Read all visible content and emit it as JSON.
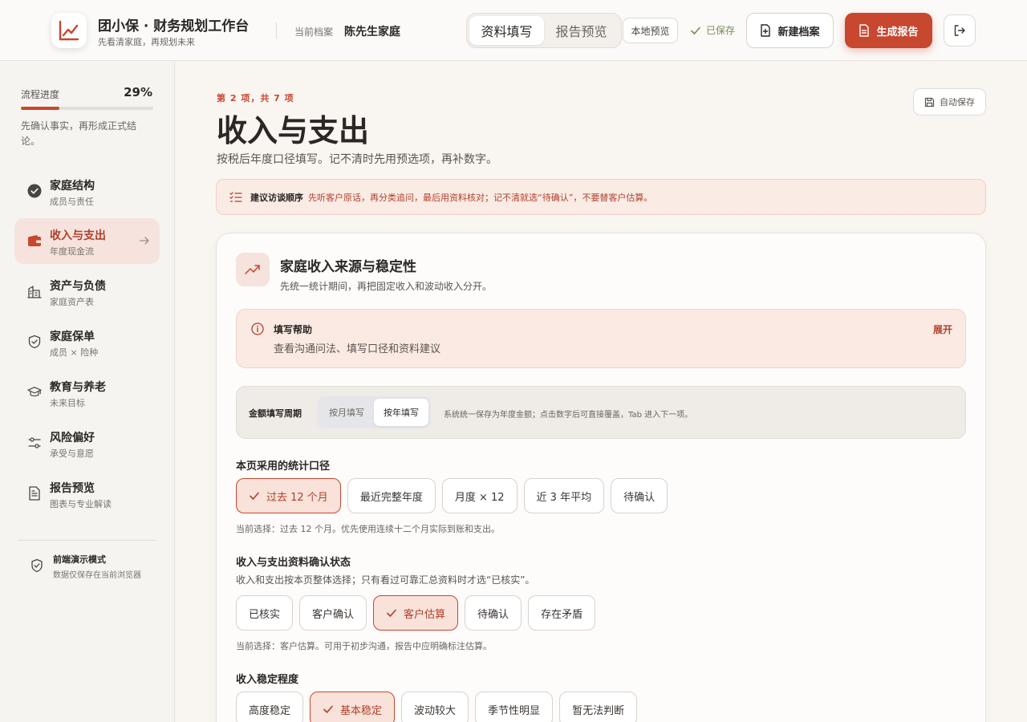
{
  "header": {
    "app_title": "团小保 · 财务规划工作台",
    "app_subtitle": "先看清家庭，再规划未来",
    "profile_label": "当前档案",
    "profile_name": "陈先生家庭",
    "tabs": [
      {
        "label": "资料填写",
        "active": true
      },
      {
        "label": "报告预览",
        "active": false
      }
    ],
    "local_preview": "本地预览",
    "saved_status": "已保存",
    "new_profile": "新建档案",
    "generate_report": "生成报告",
    "accent_color": "#c8472f"
  },
  "sidebar": {
    "progress_label": "流程进度",
    "progress_percent": "29%",
    "progress_value": 0.29,
    "progress_note": "先确认事实，再形成正式结论。",
    "items": [
      {
        "title": "家庭结构",
        "subtitle": "成员与责任",
        "icon": "check-circle-icon",
        "active": false
      },
      {
        "title": "收入与支出",
        "subtitle": "年度现金流",
        "icon": "wallet-icon",
        "active": true
      },
      {
        "title": "资产与负债",
        "subtitle": "家庭资产表",
        "icon": "building-icon",
        "active": false
      },
      {
        "title": "家庭保单",
        "subtitle": "成员 × 险种",
        "icon": "shield-icon",
        "active": false
      },
      {
        "title": "教育与养老",
        "subtitle": "未来目标",
        "icon": "graduation-cap-icon",
        "active": false
      },
      {
        "title": "风险偏好",
        "subtitle": "承受与意愿",
        "icon": "sliders-icon",
        "active": false
      },
      {
        "title": "报告预览",
        "subtitle": "图表与专业解读",
        "icon": "document-icon",
        "active": false
      }
    ],
    "demo_title": "前端演示模式",
    "demo_subtitle": "数据仅保存在当前浏览器"
  },
  "main": {
    "step": "第 2 项，共 7 项",
    "title": "收入与支出",
    "description": "按税后年度口径填写。记不清时先用预选项，再补数字。",
    "autosave": "自动保存",
    "tip_heading": "建议访谈顺序",
    "tip_text": "先听客户原话，再分类追问，最后用资料核对；记不清就选“待确认”，不要替客户估算。",
    "card": {
      "title": "家庭收入来源与稳定性",
      "subtitle": "先统一统计期间，再把固定收入和波动收入分开。",
      "help_title": "填写帮助",
      "help_text": "查看沟通问法、填写口径和资料建议",
      "help_toggle": "展开",
      "period_label": "金额填写周期",
      "period_options": [
        {
          "label": "按月填写",
          "active": false
        },
        {
          "label": "按年填写",
          "active": true
        }
      ],
      "period_note": "系统统一保存为年度金额；点击数字后可直接覆盖，Tab 进入下一项。",
      "section1": {
        "title": "本页采用的统计口径",
        "options": [
          {
            "label": "过去 12 个月",
            "selected": true
          },
          {
            "label": "最近完整年度",
            "selected": false
          },
          {
            "label": "月度 × 12",
            "selected": false
          },
          {
            "label": "近 3 年平均",
            "selected": false
          },
          {
            "label": "待确认",
            "selected": false
          }
        ],
        "note": "当前选择：过去 12 个月。优先使用连续十二个月实际到账和支出。"
      },
      "section2": {
        "title": "收入与支出资料确认状态",
        "description": "收入和支出按本页整体选择；只有看过可靠汇总资料时才选“已核实”。",
        "options": [
          {
            "label": "已核实",
            "selected": false
          },
          {
            "label": "客户确认",
            "selected": false
          },
          {
            "label": "客户估算",
            "selected": true
          },
          {
            "label": "待确认",
            "selected": false
          },
          {
            "label": "存在矛盾",
            "selected": false
          }
        ],
        "note": "当前选择：客户估算。可用于初步沟通，报告中应明确标注估算。"
      },
      "section3": {
        "title": "收入稳定程度",
        "options": [
          {
            "label": "高度稳定",
            "selected": false
          },
          {
            "label": "基本稳定",
            "selected": true
          },
          {
            "label": "波动较大",
            "selected": false
          },
          {
            "label": "季节性明显",
            "selected": false
          },
          {
            "label": "暂无法判断",
            "selected": false
          }
        ]
      }
    }
  }
}
